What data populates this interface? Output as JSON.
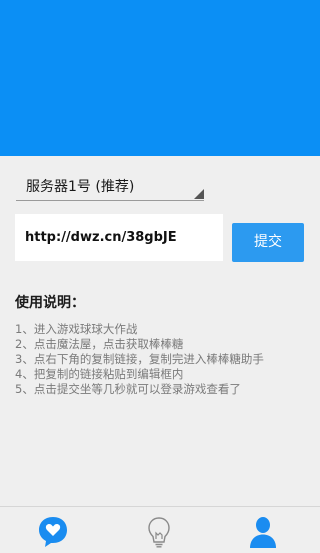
{
  "header": {
    "color": "#0b8ff5"
  },
  "server_select": {
    "selected": "服务器1号 (推荐)"
  },
  "url_input": {
    "value": "http://dwz.cn/38gbJE"
  },
  "submit_button": {
    "label": "提交",
    "color": "#2c9af0"
  },
  "instructions": {
    "title": "使用说明：",
    "steps": [
      "1、进入游戏球球大作战",
      "2、点击魔法屋，点击获取棒棒糖",
      "3、点右下角的复制链接，复制完进入棒棒糖助手",
      "4、把复制的链接粘贴到编辑框内",
      "5、点击提交坐等几秒就可以登录游戏查看了"
    ]
  },
  "bottom_nav": {
    "items": [
      {
        "icon": "heart-chat-icon",
        "active": true
      },
      {
        "icon": "lightbulb-icon",
        "active": false
      },
      {
        "icon": "person-icon",
        "active": true
      }
    ],
    "active_color": "#1a8cf0",
    "inactive_color": "#8a8a8a"
  }
}
